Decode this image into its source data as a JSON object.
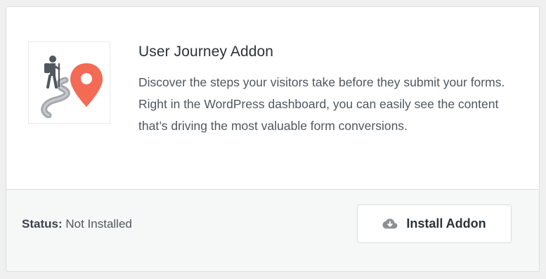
{
  "addon": {
    "title": "User Journey Addon",
    "description": "Discover the steps your visitors take before they submit your forms. Right in the WordPress dashboard, you can easily see the content that’s driving the most valuable form conversions.",
    "icon": "hiker-map-pin-icon"
  },
  "status": {
    "label": "Status:",
    "value": "Not Installed"
  },
  "install_button": {
    "label": "Install Addon",
    "icon": "cloud-download-icon"
  },
  "colors": {
    "pin": "#f36a55",
    "path": "#9a9ea3",
    "hiker": "#50575e"
  }
}
